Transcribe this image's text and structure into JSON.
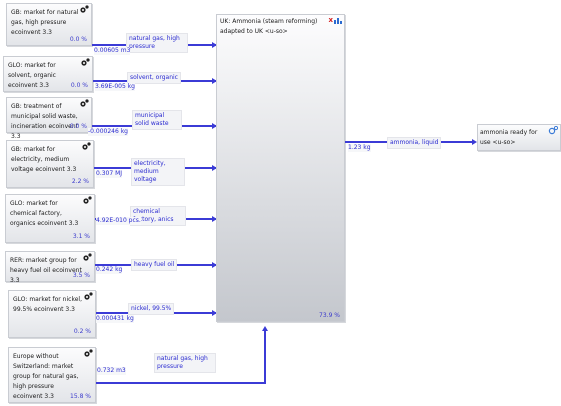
{
  "sources": [
    {
      "title": "GB: market for natural gas, high pressure ecoinvent 3.3",
      "percent": "0.0 %",
      "flow": "natural gas, high pressure",
      "amount": "0.00605 m3"
    },
    {
      "title": "GLO: market for solvent, organic ecoinvent 3.3",
      "percent": "0.0 %",
      "flow": "solvent, organic",
      "amount": "3.69E-005 kg"
    },
    {
      "title": "GB: treatment of municipal solid waste, incineration ecoinvent 3.3",
      "percent": "0.0 %",
      "flow": "municipal solid waste",
      "amount": "-0.000246 kg"
    },
    {
      "title": "GB: market for electricity, medium voltage ecoinvent 3.3",
      "percent": "2.2 %",
      "flow": "electricity, medium voltage",
      "amount": "0.307 MJ"
    },
    {
      "title": "GLO: market for chemical factory, organics ecoinvent 3.3",
      "percent": "3.1 %",
      "flow": "chemical factory, anics",
      "amount": "4.92E-010 pcs."
    },
    {
      "title": "RER: market group for heavy fuel oil ecoinvent 3.3",
      "percent": "3.5 %",
      "flow": "heavy fuel oil",
      "amount": "0.242 kg"
    },
    {
      "title": "GLO: market for nickel, 99.5% ecoinvent 3.3",
      "percent": "0.2 %",
      "flow": "nickel, 99.5%",
      "amount": "0.000431 kg"
    },
    {
      "title": "Europe without Switzerland: market group for natural gas, high pressure ecoinvent 3.3",
      "percent": "15.8 %",
      "flow": "natural gas, high pressure",
      "amount": "0.732 m3"
    }
  ],
  "main_process": {
    "title": "UK: Ammonia (steam reforming) adapted to UK <u-so>",
    "percent": "73.9 %",
    "close_label": "x"
  },
  "output_flow": {
    "flow": "ammonia, liquid",
    "amount": "1.23 kg"
  },
  "product": {
    "title": "ammonia ready for use <u-so>"
  },
  "colors": {
    "line": "#3b3bd6",
    "percent": "#3a3acc",
    "close": "#d32020"
  }
}
